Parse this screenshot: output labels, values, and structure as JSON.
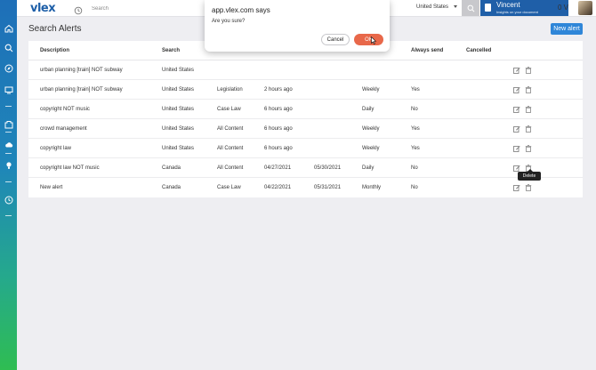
{
  "app": {
    "logo": "vlex"
  },
  "header": {
    "search_placeholder": "Search",
    "country": "United States",
    "user_name": "Vincent",
    "user_sub": "Insights on your document",
    "credit": "0 V"
  },
  "page": {
    "title": "Search Alerts",
    "new_alert_label": "New alert"
  },
  "table": {
    "headers": [
      "Description",
      "Search",
      "",
      "",
      "",
      "",
      "Always send",
      "Cancelled"
    ],
    "rows": [
      {
        "description": "urban planning [train] NOT subway",
        "search": "United States",
        "type": "",
        "date": "",
        "end": "",
        "frequency": "",
        "always_send": ""
      },
      {
        "description": "urban planning [train] NOT subway",
        "search": "United States",
        "type": "Legislation",
        "date": "2 hours ago",
        "end": "",
        "frequency": "Weekly",
        "always_send": "Yes"
      },
      {
        "description": "copyright NOT music",
        "search": "United States",
        "type": "Case Law",
        "date": "6 hours ago",
        "end": "",
        "frequency": "Daily",
        "always_send": "No"
      },
      {
        "description": "crowd management",
        "search": "United States",
        "type": "All Content",
        "date": "6 hours ago",
        "end": "",
        "frequency": "Weekly",
        "always_send": "Yes"
      },
      {
        "description": "copyright law",
        "search": "United States",
        "type": "All Content",
        "date": "6 hours ago",
        "end": "",
        "frequency": "Weekly",
        "always_send": "Yes"
      },
      {
        "description": "copyright law NOT music",
        "search": "Canada",
        "type": "All Content",
        "date": "04/27/2021",
        "end": "05/30/2021",
        "frequency": "Daily",
        "always_send": "No"
      },
      {
        "description": "New alert",
        "search": "Canada",
        "type": "Case Law",
        "date": "04/22/2021",
        "end": "05/31/2021",
        "frequency": "Monthly",
        "always_send": "No"
      }
    ],
    "row0_partial": {
      "type": "Legislation",
      "date": "2 hours ago",
      "frequency": "Weekly",
      "always_send": "Yes"
    }
  },
  "tooltip": {
    "text": "Delete"
  },
  "dialog": {
    "title": "app.vlex.com says",
    "message": "Are you sure?",
    "cancel_label": "Cancel",
    "ok_label": "OK"
  },
  "colors": {
    "brand_blue": "#1f5fa8",
    "accent_blue": "#2f86d8",
    "ok_button": "#e8684a",
    "rail_green": "#2fbd52"
  }
}
